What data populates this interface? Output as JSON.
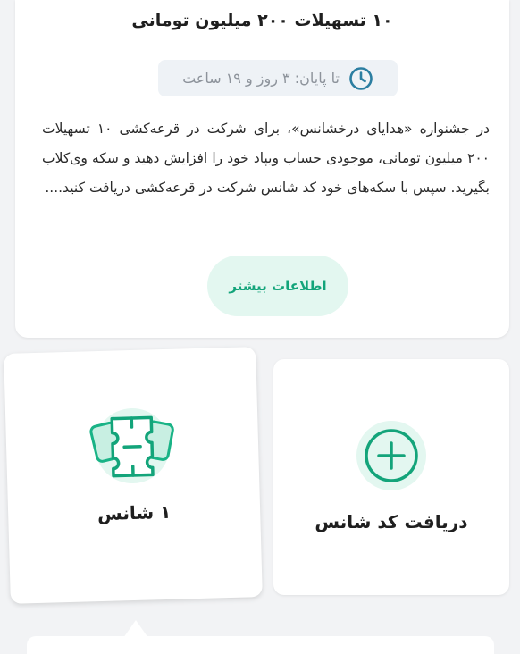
{
  "campaign": {
    "title": "۱۰ تسهیلات ۲۰۰ میلیون تومانی",
    "deadline_text": "تا پایان: ۳ روز و ۱۹ ساعت",
    "deadline_icon": "clock-icon",
    "description": "در جشنواره «هدایای درخشانس»، برای شرکت در قرعه‌کشی ۱۰ تسهیلات ۲۰۰ میلیون تومانی، موجودی حساب ویپاد خود را افزایش دهید و سکه وی‌کلاب بگیرید. سپس با سکه‌های خود کد شانس شرکت در قرعه‌کشی دریافت کنید....",
    "more_button_label": "اطلاعات بیشتر"
  },
  "chances_card": {
    "icon": "ticket-icon",
    "label": "۱ شانس"
  },
  "get_code_card": {
    "icon": "plus-circle-icon",
    "label": "دریافت کد شانس"
  },
  "colors": {
    "accent": "#13a47a",
    "accent_light": "#e3f7f0",
    "background": "#f2f3f5",
    "deadline_bg": "#eef2f6",
    "deadline_text": "#8d939b",
    "clock": "#2b7ea1"
  }
}
